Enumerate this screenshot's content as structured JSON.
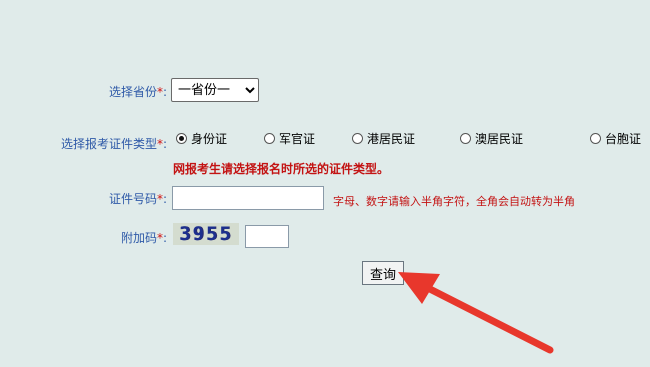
{
  "province": {
    "label": "选择省份",
    "required_mark": "*",
    "colon": ":",
    "selected": "一省份一"
  },
  "cert_type": {
    "label": "选择报考证件类型",
    "required_mark": "*",
    "colon": ":",
    "options": [
      {
        "label": "身份证",
        "checked": true
      },
      {
        "label": "军官证",
        "checked": false
      },
      {
        "label": "港居民证",
        "checked": false
      },
      {
        "label": "澳居民证",
        "checked": false
      },
      {
        "label": "台胞证",
        "checked": false
      }
    ],
    "warning": "网报考生请选择报名时所选的证件类型。"
  },
  "cert_number": {
    "label": "证件号码",
    "required_mark": "*",
    "colon": ":",
    "value": "",
    "hint": "字母、数字请输入半角字符，全角会自动转为半角"
  },
  "captcha": {
    "label": "附加码",
    "required_mark": "*",
    "colon": ":",
    "image_text": "3955",
    "value": ""
  },
  "submit": {
    "label": "查询"
  },
  "annotation": {
    "arrow_color": "#e8372c"
  }
}
